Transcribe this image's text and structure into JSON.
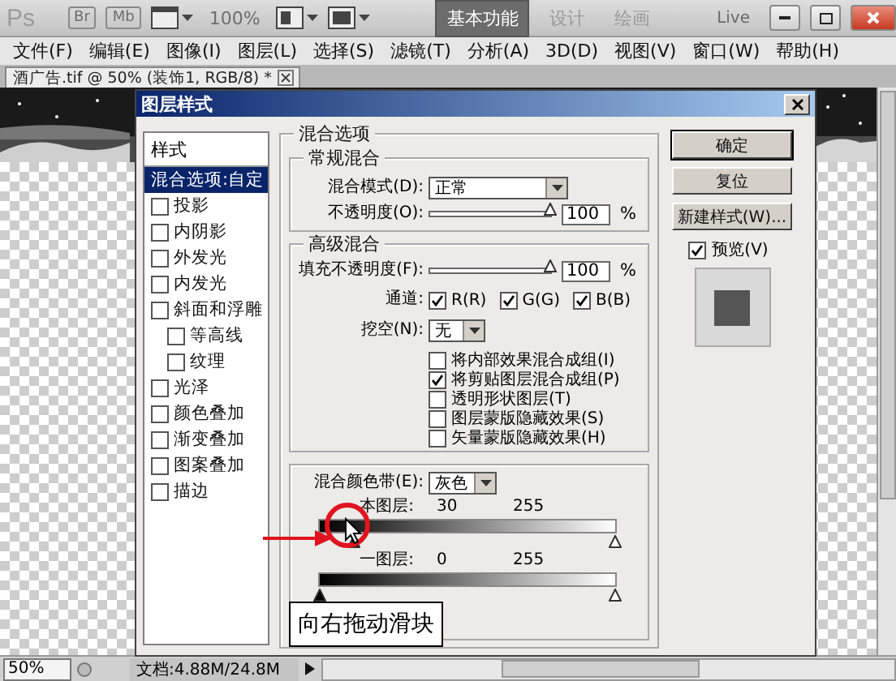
{
  "toolbar": {
    "logo": "Ps",
    "bridge": "Br",
    "mini_bridge": "Mb",
    "zoom": "100%",
    "workspaces": [
      {
        "label": "基本功能",
        "selected": true
      },
      {
        "label": "设计",
        "selected": false
      },
      {
        "label": "绘画",
        "selected": false
      }
    ],
    "live": "Live"
  },
  "menu": [
    "文件(F)",
    "编辑(E)",
    "图像(I)",
    "图层(L)",
    "选择(S)",
    "滤镜(T)",
    "分析(A)",
    "3D(D)",
    "视图(V)",
    "窗口(W)",
    "帮助(H)"
  ],
  "document_tab": {
    "title": "酒广告.tif @ 50% (装饰1, RGB/8) *"
  },
  "dialog": {
    "title": "图层样式",
    "styles_header": "样式",
    "styles": [
      {
        "kind": "plain",
        "label": "混合选项:自定",
        "selected": true
      },
      {
        "kind": "check",
        "label": "投影",
        "checked": false,
        "selected": false
      },
      {
        "kind": "check",
        "label": "内阴影",
        "checked": false,
        "selected": false
      },
      {
        "kind": "check",
        "label": "外发光",
        "checked": false,
        "selected": false
      },
      {
        "kind": "check",
        "label": "内发光",
        "checked": false,
        "selected": false
      },
      {
        "kind": "check",
        "label": "斜面和浮雕",
        "checked": false,
        "selected": false,
        "children": [
          {
            "kind": "check",
            "label": "等高线",
            "checked": false,
            "selected": false
          },
          {
            "kind": "check",
            "label": "纹理",
            "checked": false,
            "selected": false
          }
        ]
      },
      {
        "kind": "check",
        "label": "光泽",
        "checked": false,
        "selected": false
      },
      {
        "kind": "check",
        "label": "颜色叠加",
        "checked": false,
        "selected": false
      },
      {
        "kind": "check",
        "label": "渐变叠加",
        "checked": false,
        "selected": false
      },
      {
        "kind": "check",
        "label": "图案叠加",
        "checked": false,
        "selected": false
      },
      {
        "kind": "check",
        "label": "描边",
        "checked": false,
        "selected": false
      }
    ],
    "blending": {
      "title": "混合选项",
      "general": {
        "title": "常规混合",
        "mode_label": "混合模式(D):",
        "mode": "正常",
        "opacity_label": "不透明度(O):",
        "opacity_slider": {
          "level": 1
        },
        "opacity": "100",
        "unit": "%"
      },
      "advanced": {
        "title": "高级混合",
        "fill_label": "填充不透明度(F):",
        "fill_slider": {
          "level": 1
        },
        "fill": "100",
        "unit": "%",
        "channels_label": "通道:",
        "channels": [
          {
            "label": "R(R)",
            "checked": true
          },
          {
            "label": "G(G)",
            "checked": true
          },
          {
            "label": "B(B)",
            "checked": true
          }
        ],
        "knockout_label": "挖空(N):",
        "knockout": "无",
        "options": [
          {
            "label": "将内部效果混合成组(I)",
            "checked": false
          },
          {
            "label": "将剪贴图层混合成组(P)",
            "checked": true
          },
          {
            "label": "透明形状图层(T)",
            "checked": false
          },
          {
            "label": "图层蒙版隐藏效果(S)",
            "checked": false
          },
          {
            "label": "矢量蒙版隐藏效果(H)",
            "checked": false
          }
        ]
      },
      "blend_if": {
        "label": "混合颜色带(E):",
        "value": "灰色",
        "bands": [
          {
            "label": "本图层:",
            "low": "30",
            "high": "255",
            "thumbs": [
              {
                "level": 0.118
              },
              {
                "level": 1
              }
            ]
          },
          {
            "label": "一图层:",
            "low": "0",
            "high": "255",
            "thumbs": [
              {
                "level": 0
              },
              {
                "level": 1
              }
            ]
          }
        ]
      }
    },
    "buttons": [
      {
        "label": "确定",
        "default": true
      },
      {
        "label": "复位",
        "default": false
      },
      {
        "label": "新建样式(W)...",
        "default": false
      }
    ],
    "preview": {
      "label": "预览(V)",
      "checked": true
    }
  },
  "callout": "向右拖动滑块",
  "status_bar": {
    "zoom": "50%",
    "doc_info": "文档:4.88M/24.8M"
  }
}
